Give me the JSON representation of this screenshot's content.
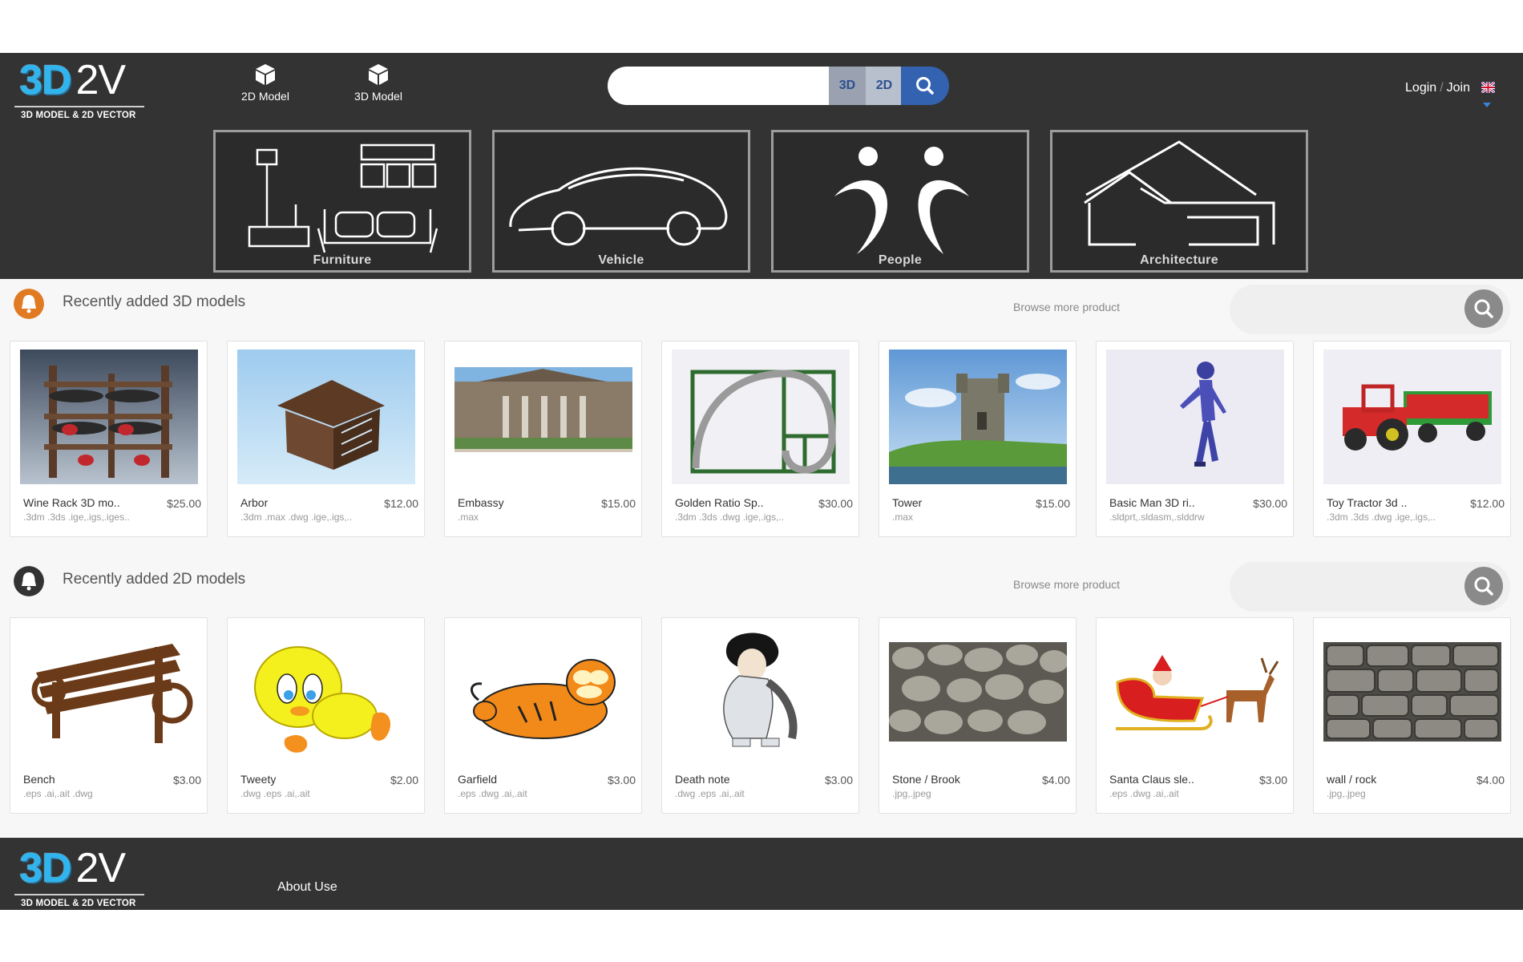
{
  "brand": {
    "logo_3d": "3D",
    "logo_2v": "2V",
    "tagline": "3D MODEL & 2D VECTOR",
    "accent": "#2fb4ee"
  },
  "nav": {
    "items": [
      {
        "label": "2D Model",
        "icon": "cube-icon"
      },
      {
        "label": "3D Model",
        "icon": "cube-icon"
      }
    ]
  },
  "search": {
    "value": "",
    "placeholder": "",
    "btn_3d": "3D",
    "btn_2d": "2D",
    "icon": "search-icon"
  },
  "account": {
    "login": "Login",
    "separator": "/",
    "join": "Join",
    "flag": "uk-flag-icon"
  },
  "categories": [
    {
      "label": "Furniture"
    },
    {
      "label": "Vehicle"
    },
    {
      "label": "People"
    },
    {
      "label": "Architecture"
    }
  ],
  "sections": {
    "models_3d": {
      "title": "Recently added 3D models",
      "browse": "Browse more product",
      "icon_color": "#e07b24",
      "items": [
        {
          "name": "Wine Rack 3D mo..",
          "price": "$25.00",
          "formats": ".3dm .3ds .ige,.igs,.iges.."
        },
        {
          "name": "Arbor",
          "price": "$12.00",
          "formats": ".3dm .max .dwg .ige,.igs,.."
        },
        {
          "name": "Embassy",
          "price": "$15.00",
          "formats": ".max"
        },
        {
          "name": "Golden Ratio Sp..",
          "price": "$30.00",
          "formats": ".3dm .3ds .dwg .ige,.igs,.."
        },
        {
          "name": "Tower",
          "price": "$15.00",
          "formats": ".max"
        },
        {
          "name": "Basic Man 3D ri..",
          "price": "$30.00",
          "formats": ".sldprt,.sldasm,.slddrw"
        },
        {
          "name": "Toy Tractor 3d ..",
          "price": "$12.00",
          "formats": ".3dm .3ds .dwg .ige,.igs,.."
        }
      ]
    },
    "models_2d": {
      "title": "Recently added 2D models",
      "browse": "Browse more product",
      "icon_color": "#333333",
      "items": [
        {
          "name": "Bench",
          "price": "$3.00",
          "formats": ".eps .ai,.ait .dwg"
        },
        {
          "name": "Tweety",
          "price": "$2.00",
          "formats": ".dwg .eps .ai,.ait"
        },
        {
          "name": "Garfield",
          "price": "$3.00",
          "formats": ".eps .dwg .ai,.ait"
        },
        {
          "name": "Death note",
          "price": "$3.00",
          "formats": ".dwg .eps .ai,.ait"
        },
        {
          "name": "Stone / Brook",
          "price": "$4.00",
          "formats": ".jpg,.jpeg"
        },
        {
          "name": "Santa Claus sle..",
          "price": "$3.00",
          "formats": ".eps .dwg .ai,.ait"
        },
        {
          "name": "wall / rock",
          "price": "$4.00",
          "formats": ".jpg,.jpeg"
        }
      ]
    }
  },
  "footer": {
    "about": "About Use"
  }
}
